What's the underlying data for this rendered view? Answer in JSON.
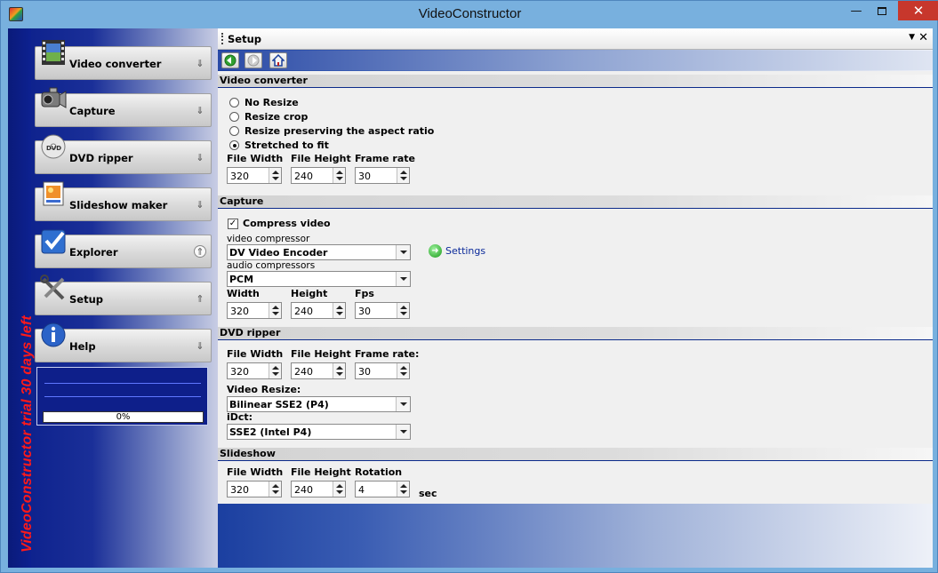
{
  "window": {
    "title": "VideoConstructor",
    "minimize_glyph": "—",
    "close_glyph": "✕"
  },
  "sidebar": {
    "trial_text": "VideoConstructor trial 30 days left",
    "items": [
      {
        "label": "Video converter",
        "icon": "film-icon",
        "expanded": false
      },
      {
        "label": "Capture",
        "icon": "camcorder-icon",
        "expanded": false
      },
      {
        "label": "DVD ripper",
        "icon": "dvd-icon",
        "expanded": false
      },
      {
        "label": "Slideshow maker",
        "icon": "slideshow-icon",
        "expanded": false
      },
      {
        "label": "Explorer",
        "icon": "checkmark-icon",
        "expanded": true
      },
      {
        "label": "Setup",
        "icon": "tools-icon",
        "expanded": true
      },
      {
        "label": "Help",
        "icon": "info-icon",
        "expanded": false
      }
    ],
    "progress": {
      "text": "0%",
      "value": 0
    }
  },
  "panel": {
    "title": "Setup",
    "nav": {
      "back": "back-icon",
      "forward": "forward-icon",
      "home": "home-icon"
    }
  },
  "video_converter": {
    "heading": "Video converter",
    "options": [
      "No Resize",
      "Resize crop",
      "Resize preserving the aspect ratio",
      "Stretched to fit"
    ],
    "selected": "Stretched to fit",
    "width_label": "File Width",
    "width": "320",
    "height_label": "File Height",
    "height": "240",
    "rate_label": "Frame rate",
    "rate": "30"
  },
  "capture": {
    "heading": "Capture",
    "compress_label": "Compress video",
    "compress_checked": true,
    "video_compressor_label": "video compressor",
    "video_compressor": "DV Video Encoder",
    "settings_label": "Settings",
    "audio_compressor_label": "audio compressors",
    "audio_compressor": "PCM",
    "width_label": "Width",
    "width": "320",
    "height_label": "Height",
    "height": "240",
    "fps_label": "Fps",
    "fps": "30"
  },
  "dvd_ripper": {
    "heading": "DVD ripper",
    "width_label": "File Width",
    "width": "320",
    "height_label": "File Height",
    "height": "240",
    "rate_label": "Frame rate:",
    "rate": "30",
    "resize_label": "Video Resize:",
    "resize": "Bilinear SSE2 (P4)",
    "idct_label": "iDct:",
    "idct": "SSE2 (Intel P4)"
  },
  "slideshow": {
    "heading": "Slideshow",
    "width_label": "File Width",
    "width": "320",
    "height_label": "File Height",
    "height": "240",
    "rotation_label": "Rotation",
    "rotation": "4",
    "unit": "sec"
  }
}
